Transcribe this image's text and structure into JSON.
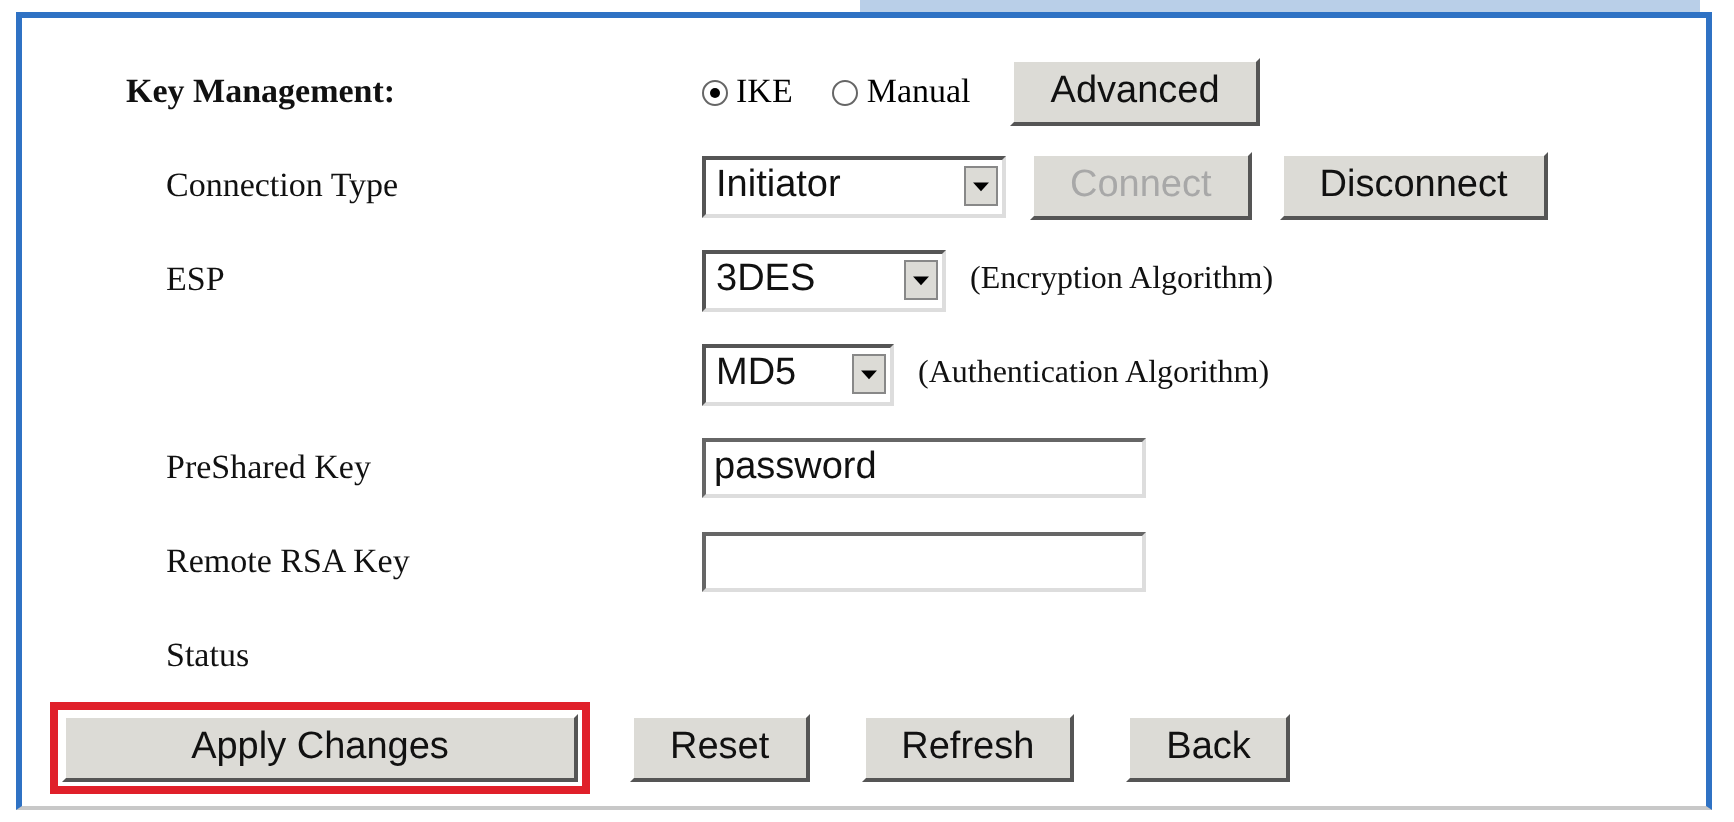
{
  "key_management": {
    "label": "Key Management:",
    "options": [
      {
        "label": "IKE",
        "selected": true
      },
      {
        "label": "Manual",
        "selected": false
      }
    ],
    "advanced_button": "Advanced"
  },
  "fields": [
    {
      "kind": "select",
      "label": "Connection Type",
      "value": "Initiator",
      "buttons": [
        {
          "label": "Connect",
          "disabled": true
        },
        {
          "label": "Disconnect",
          "disabled": false
        }
      ]
    },
    {
      "kind": "select",
      "label": "ESP",
      "value": "3DES",
      "note": "(Encryption Algorithm)"
    },
    {
      "kind": "select",
      "value": "MD5",
      "note": "(Authentication Algorithm)"
    },
    {
      "kind": "input",
      "label": "PreShared Key",
      "value": "password"
    },
    {
      "kind": "input",
      "label": "Remote RSA Key"
    },
    {
      "kind": "text",
      "label": "Status"
    }
  ],
  "buttons": [
    {
      "label": "Apply Changes",
      "highlighted": true
    },
    {
      "label": "Reset",
      "highlighted": false
    },
    {
      "label": "Refresh",
      "highlighted": false
    },
    {
      "label": "Back",
      "highlighted": false
    }
  ]
}
